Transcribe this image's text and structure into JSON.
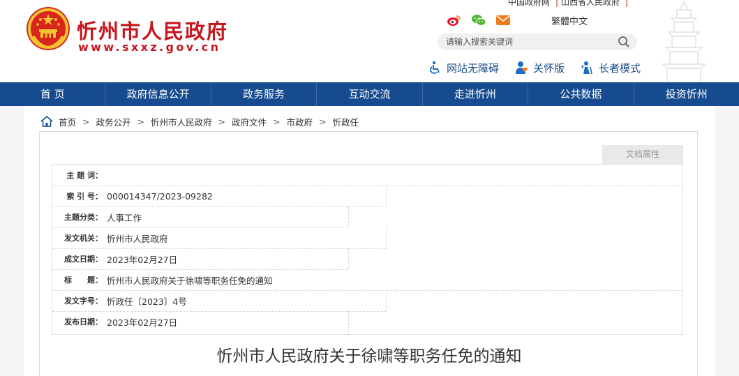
{
  "header": {
    "site_title": "忻州市人民政府",
    "site_url": "www.sxxz.gov.cn",
    "top_links": [
      "中国政府网",
      "山西省人民政府"
    ],
    "lang_switch": "繁體中文",
    "search_placeholder": "请输入搜索关键词",
    "accessibility": [
      {
        "label": "网站无障碍",
        "icon": "wheelchair-icon"
      },
      {
        "label": "关怀版",
        "icon": "care-icon"
      },
      {
        "label": "长者模式",
        "icon": "elder-icon"
      }
    ],
    "social_icons": [
      "weibo-icon",
      "wechat-icon",
      "mail-icon"
    ],
    "colors": {
      "brand_red": "#c4161c",
      "nav_blue": "#164b8f",
      "link_blue": "#1a4b8c"
    }
  },
  "nav": {
    "items": [
      "首 页",
      "政府信息公开",
      "政务服务",
      "互动交流",
      "走进忻州",
      "公共数据",
      "投资忻州"
    ]
  },
  "breadcrumb": [
    "首页",
    "政务公开",
    "忻州市人民政府",
    "政府文件",
    "市政府",
    "忻政任"
  ],
  "doc": {
    "attr_tab": "文档属性",
    "meta": [
      {
        "key": "主 题 词：",
        "value": ""
      },
      {
        "key": "索 引 号：",
        "value": "000014347/2023-09282"
      },
      {
        "key": "主题分类：",
        "value": "人事工作"
      },
      {
        "key": "发文机关：",
        "value": "忻州市人民政府"
      },
      {
        "key": "成文日期：",
        "value": "2023年02月27日"
      },
      {
        "key": "标　　题：",
        "value": "忻州市人民政府关于徐啸等职务任免的通知"
      },
      {
        "key": "发文字号：",
        "value": "忻政任〔2023〕4号"
      },
      {
        "key": "发布日期：",
        "value": "2023年02月27日"
      }
    ],
    "title": "忻州市人民政府关于徐啸等职务任免的通知"
  }
}
